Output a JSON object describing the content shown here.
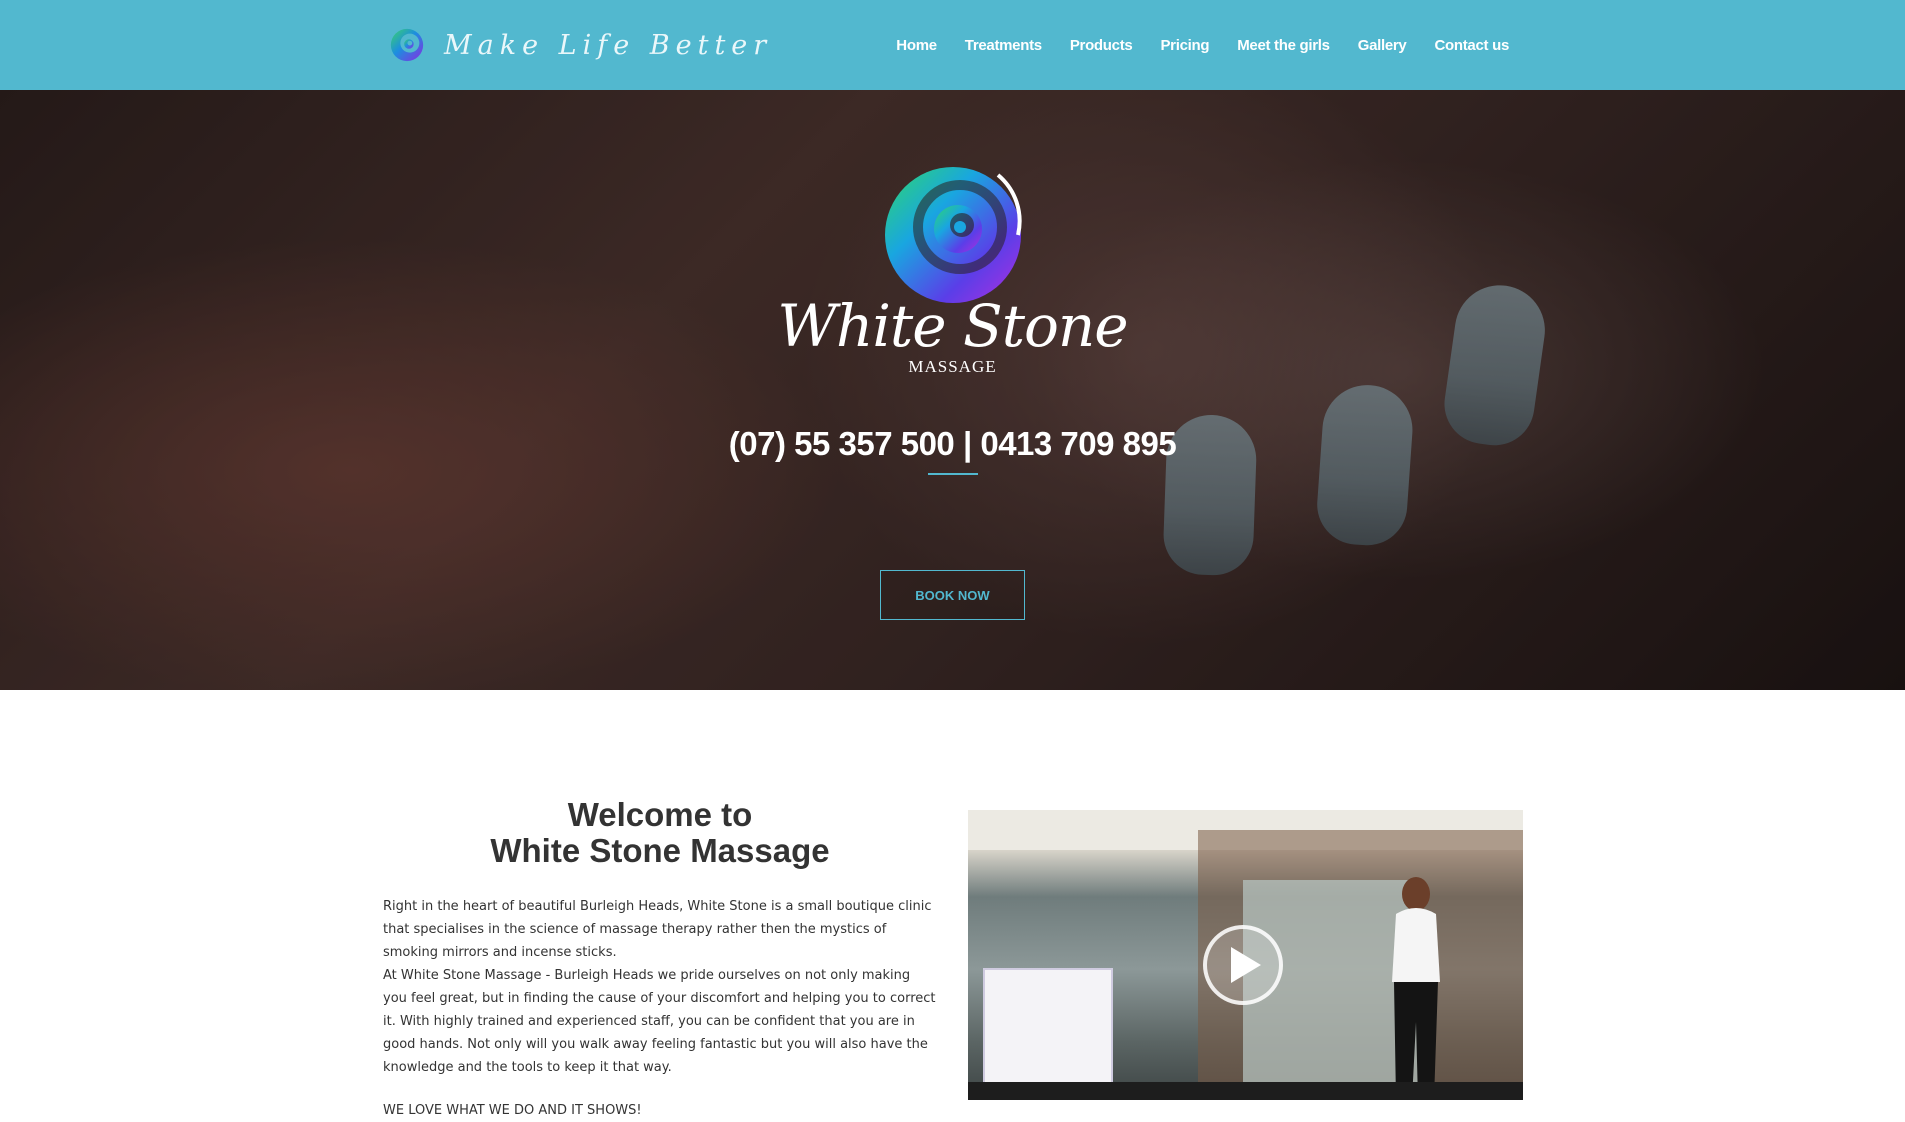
{
  "header": {
    "tagline": "Make Life Better",
    "nav": [
      {
        "label": "Home"
      },
      {
        "label": "Treatments"
      },
      {
        "label": "Products"
      },
      {
        "label": "Pricing"
      },
      {
        "label": "Meet the girls"
      },
      {
        "label": "Gallery"
      },
      {
        "label": "Contact us"
      }
    ]
  },
  "hero": {
    "brand_name": "White Stone",
    "brand_sub": "MASSAGE",
    "phone": "(07) 55 357 500 | 0413 709 895",
    "cta": "BOOK NOW"
  },
  "welcome": {
    "title_line1": "Welcome to",
    "title_line2": "White Stone Massage",
    "para1": "Right in the heart of beautiful Burleigh Heads, White Stone is a small boutique clinic that specialises in the science of massage therapy rather then the mystics of smoking mirrors and incense sticks.",
    "para2": "At White Stone Massage - Burleigh Heads we pride ourselves on not only making you feel great, but in finding the cause of your discomfort and helping you to correct it.  With highly trained and experienced staff, you can be confident that you are in good hands.  Not only will you walk away feeling fantastic but you will also have the knowledge and the tools to keep it that way.",
    "para3": "WE LOVE WHAT WE DO AND IT SHOWS!"
  },
  "video": {
    "icons": [
      "play-icon"
    ]
  },
  "colors": {
    "header_bg": "#52b8cf",
    "accent": "#52b8cf",
    "text_dark": "#333333"
  }
}
